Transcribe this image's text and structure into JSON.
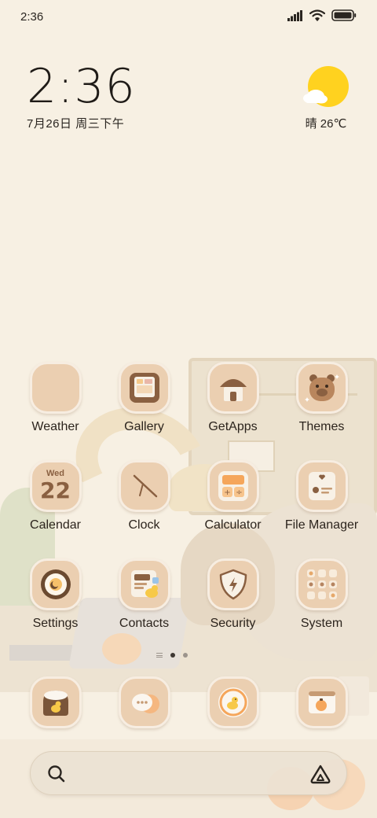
{
  "status_bar": {
    "time": "2:36",
    "icons": [
      "signal-icon",
      "wifi-icon",
      "battery-icon"
    ]
  },
  "clock_widget": {
    "time": "2:36",
    "date": "7月26日 周三下午"
  },
  "weather_widget": {
    "condition_icon": "sun-cloud-icon",
    "text": "晴 26℃"
  },
  "apps": [
    [
      {
        "label": "Weather",
        "icon": "weather-icon"
      },
      {
        "label": "Gallery",
        "icon": "gallery-icon"
      },
      {
        "label": "GetApps",
        "icon": "getapps-icon"
      },
      {
        "label": "Themes",
        "icon": "themes-icon"
      }
    ],
    [
      {
        "label": "Calendar",
        "icon": "calendar-icon",
        "day": "Wed",
        "date": "22"
      },
      {
        "label": "Clock",
        "icon": "clock-icon"
      },
      {
        "label": "Calculator",
        "icon": "calculator-icon"
      },
      {
        "label": "File Manager",
        "icon": "file-manager-icon"
      }
    ],
    [
      {
        "label": "Settings",
        "icon": "settings-icon"
      },
      {
        "label": "Contacts",
        "icon": "contacts-icon"
      },
      {
        "label": "Security",
        "icon": "security-icon"
      },
      {
        "label": "System",
        "icon": "system-folder-icon"
      }
    ]
  ],
  "page_indicator": {
    "pages": 2,
    "current": 1
  },
  "dock": [
    {
      "icon": "phone-icon"
    },
    {
      "icon": "messages-icon"
    },
    {
      "icon": "camera-icon"
    },
    {
      "icon": "browser-icon"
    }
  ],
  "search_bar": {
    "left_icon": "search-icon",
    "right_icon": "assistant-icon"
  },
  "colors": {
    "background": "#f7f0e3",
    "icon_fill": "#ebcfb1",
    "icon_border": "#f7ede1",
    "sun": "#ffd21f",
    "text": "#2c241d"
  }
}
